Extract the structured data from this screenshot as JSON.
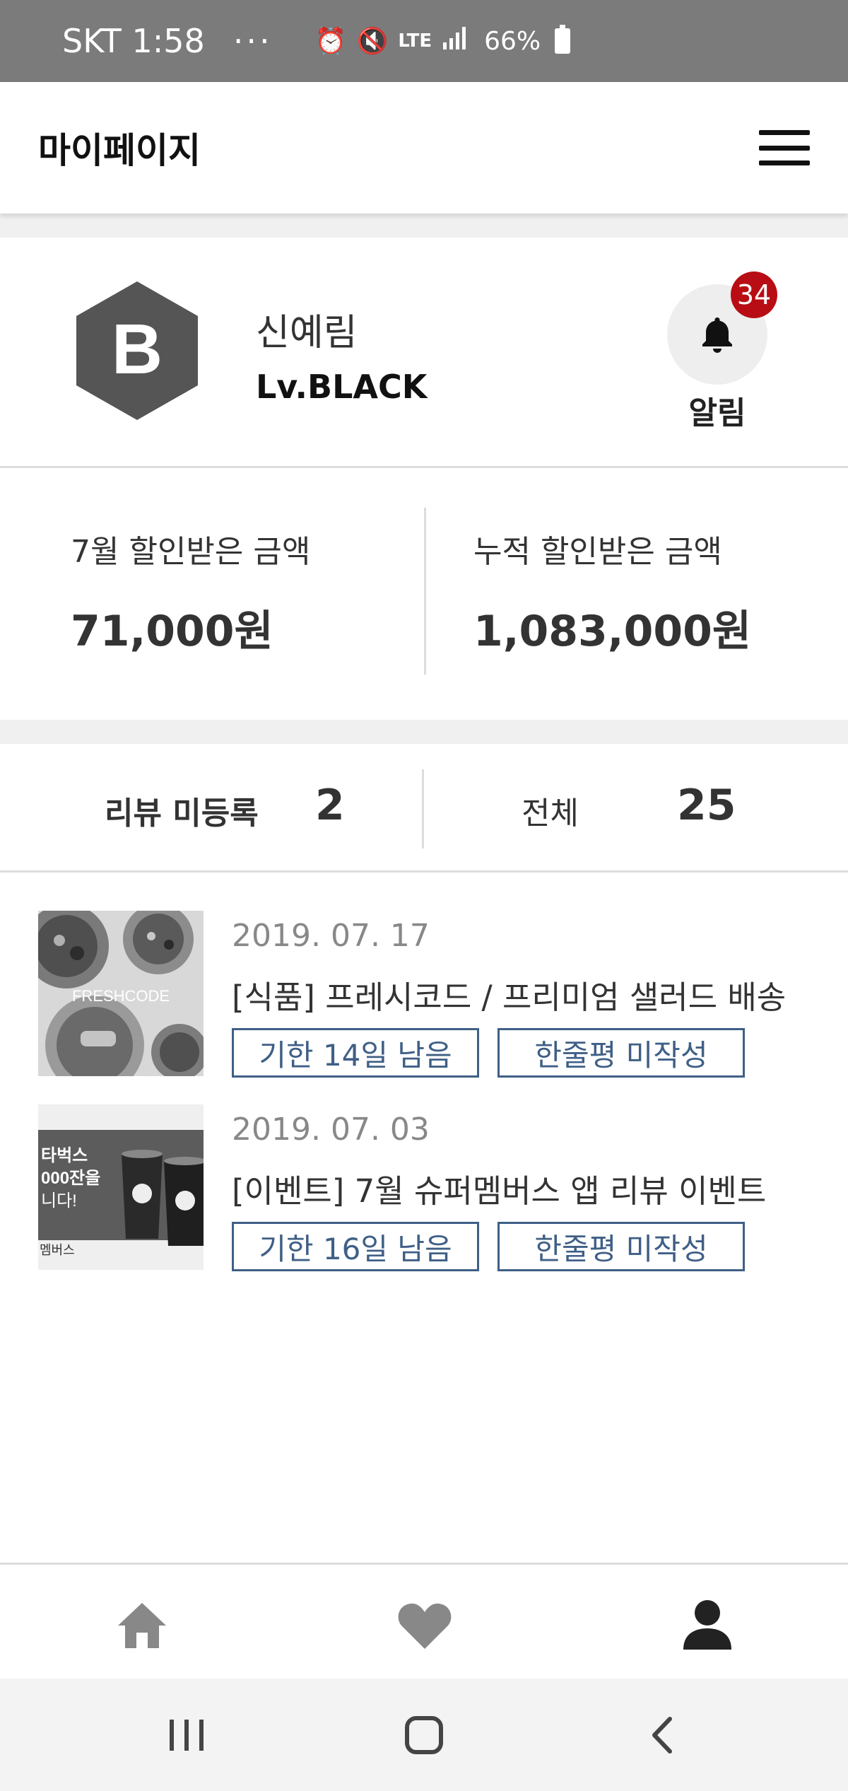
{
  "status_bar": {
    "carrier_time": "SKT 1:58",
    "more": "···",
    "network": "LTE",
    "battery": "66%"
  },
  "header": {
    "title": "마이페이지"
  },
  "profile": {
    "badge_letter": "B",
    "name": "신예림",
    "level": "Lv.BLACK",
    "notification_count": "34",
    "notification_label": "알림"
  },
  "savings": {
    "monthly_label": "7월 할인받은 금액",
    "monthly_value": "71,000원",
    "total_label": "누적 할인받은 금액",
    "total_value": "1,083,000원"
  },
  "review_summary": {
    "pending_label": "리뷰 미등록",
    "pending_count": "2",
    "total_label": "전체",
    "total_count": "25"
  },
  "review_items": [
    {
      "date": "2019. 07. 17",
      "title": "[식품] 프레시코드 / 프리미엄 샐러드 배송",
      "thumb_text": "FRESHCODE",
      "deadline": "기한 14일 남음",
      "status": "한줄평 미작성"
    },
    {
      "date": "2019. 07. 03",
      "title": "[이벤트] 7월 슈퍼멤버스 앱 리뷰 이벤트",
      "thumb_lines": [
        "타벅스",
        "000잔을",
        "니다!"
      ],
      "thumb_footer": "멤버스",
      "deadline": "기한 16일 남음",
      "status": "한줄평 미작성"
    }
  ],
  "bottom_nav": {
    "items": [
      "home-icon",
      "heart-icon",
      "person-icon"
    ],
    "active": "person-icon"
  },
  "system_nav": {
    "items": [
      "recent-apps-icon",
      "home-button-icon",
      "back-icon"
    ]
  },
  "colors": {
    "status_bar": "#7b7b7b",
    "badge_red": "#b80d14",
    "tag_blue": "#3f5f86",
    "section_gap": "#f0f0f0",
    "nav_inactive": "#888888",
    "nav_active": "#222222"
  }
}
